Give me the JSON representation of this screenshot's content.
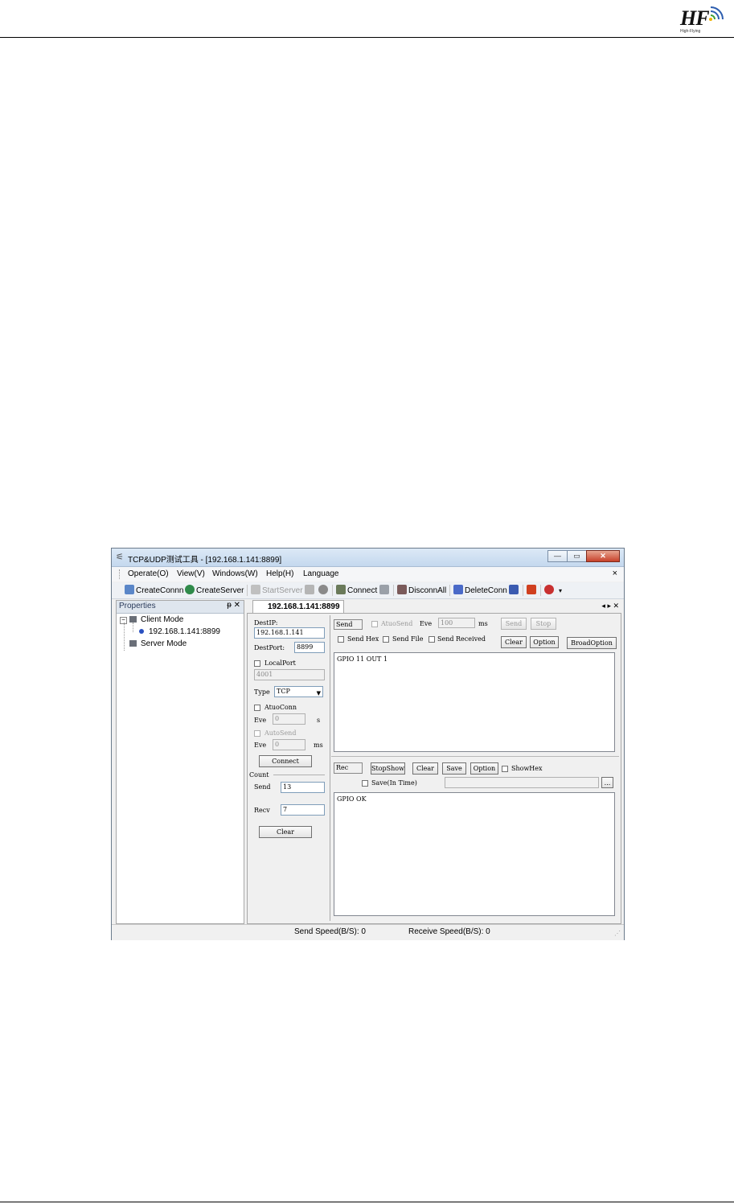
{
  "logo": {
    "text": "HF",
    "sub": "High-Flying"
  },
  "window": {
    "title": "TCP&UDP测试工具 - [192.168.1.141:8899]",
    "title_buttons": [
      "—",
      "▭",
      "✕"
    ]
  },
  "menu": {
    "items": [
      "Operate(O)",
      "View(V)",
      "Windows(W)",
      "Help(H)",
      "Language"
    ],
    "close": "×"
  },
  "toolbar": {
    "create_conn": "CreateConnn",
    "create_server": "CreateServer",
    "start_server": "StartServer",
    "connect": "Connect",
    "disconn_all": "DisconnAll",
    "delete_conn": "DeleteConn"
  },
  "properties": {
    "title": "Properties",
    "controls": "ᵽ ✕",
    "tree": {
      "client_mode": "Client Mode",
      "connection": "192.168.1.141:8899",
      "server_mode": "Server Mode"
    }
  },
  "tab": {
    "label": "192.168.1.141:8899",
    "controls": "◂ ▸ ✕"
  },
  "conn": {
    "dest_ip_label": "DestIP:",
    "dest_ip": "192.168.1.141",
    "dest_port_label": "DestPort:",
    "dest_port": "8899",
    "local_port_label": "LocalPort",
    "local_port": "4001",
    "type_label": "Type",
    "type_value": "TCP",
    "auto_conn_label": "AtuoConn",
    "eve_label": "Eve",
    "eve_conn_value": "0",
    "eve_conn_unit": "s",
    "auto_send_label": "AutoSend",
    "eve_send_value": "0",
    "eve_send_unit": "ms",
    "connect_button": "Connect",
    "count_label": "Count",
    "send_label": "Send",
    "send_count": "13",
    "recv_label": "Recv",
    "recv_count": "7",
    "clear_button": "Clear"
  },
  "send_panel": {
    "send_box_label": "Send",
    "auto_send": "AtuoSend",
    "eve_label": "Eve",
    "eve_value": "100",
    "eve_unit": "ms",
    "send_button": "Send",
    "stop_button": "Stop",
    "send_hex": "Send Hex",
    "send_file": "Send File",
    "send_received": "Send Received",
    "clear_button": "Clear",
    "option_button": "Option",
    "broad_option_button": "BroadOption",
    "content": "GPIO 11 OUT 1"
  },
  "recv_panel": {
    "rec_label": "Rec",
    "stop_show_button": "StopShow",
    "clear_button": "Clear",
    "save_button": "Save",
    "option_button": "Option",
    "show_hex": "ShowHex",
    "save_in_time": "Save(In Time)",
    "browse_button": "...",
    "content": "GPIO OK"
  },
  "status": {
    "send_speed": "Send Speed(B/S): 0",
    "receive_speed": "Receive Speed(B/S): 0"
  }
}
